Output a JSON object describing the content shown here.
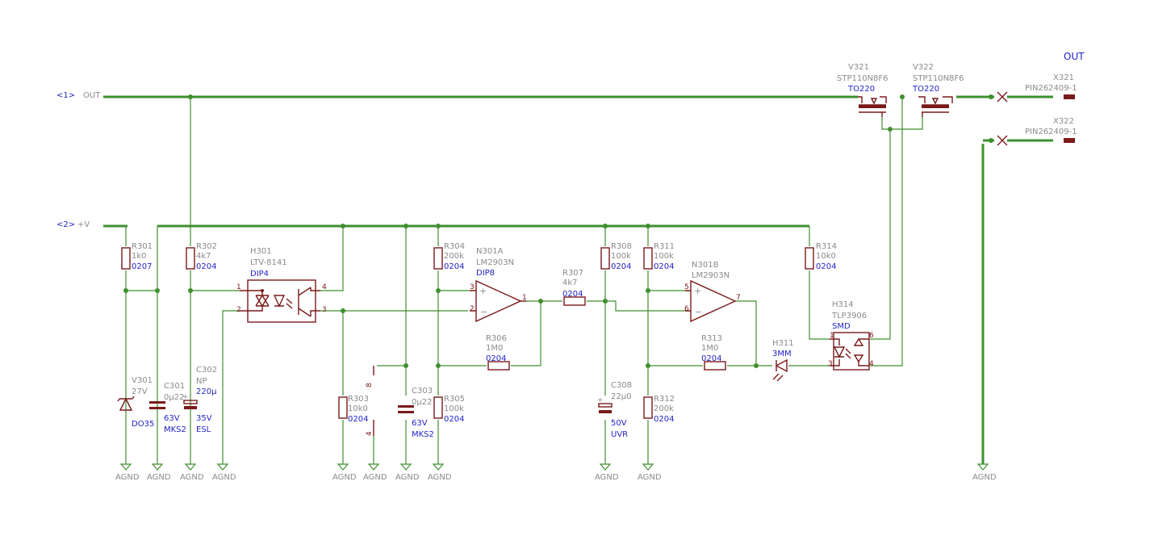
{
  "sheet": {
    "label": "OUT"
  },
  "nets": {
    "out_ref": "<1>",
    "out_name": "OUT",
    "vplus_ref": "<2>",
    "vplus_name": "+V"
  },
  "gnd_label": "AGND",
  "components": {
    "R301": {
      "name": "R301",
      "value": "1k0",
      "pkg": "0207"
    },
    "R302": {
      "name": "R302",
      "value": "4k7",
      "pkg": "0204"
    },
    "H301": {
      "name": "H301",
      "value": "LTV-8141",
      "pkg": "DIP4"
    },
    "V301": {
      "name": "V301",
      "value": "27V",
      "pkg": "DO35"
    },
    "C301": {
      "name": "C301",
      "value": "0µ22",
      "rating": "63V",
      "pkg": "MKS2"
    },
    "C302": {
      "name": "C302",
      "type": "NP",
      "value": "220µ",
      "rating": "35V",
      "pkg": "ESL"
    },
    "R303": {
      "name": "R303",
      "value": "10k0",
      "pkg": "0204"
    },
    "C303": {
      "name": "C303",
      "value": "0µ22",
      "rating": "63V",
      "pkg": "MKS2"
    },
    "R304": {
      "name": "R304",
      "value": "200k",
      "pkg": "0204"
    },
    "R305": {
      "name": "R305",
      "value": "100k",
      "pkg": "0204"
    },
    "N301A": {
      "name": "N301A",
      "value": "LM2903N",
      "pkg": "DIP8"
    },
    "N301B": {
      "name": "N301B",
      "value": "LM2903N"
    },
    "R306": {
      "name": "R306",
      "value": "1M0",
      "pkg": "0204"
    },
    "R307": {
      "name": "R307",
      "value": "4k7",
      "pkg": "0204"
    },
    "R308": {
      "name": "R308",
      "value": "100k",
      "pkg": "0204"
    },
    "C308": {
      "name": "C308",
      "value": "22µ0",
      "rating": "50V",
      "pkg": "UVR"
    },
    "R311": {
      "name": "R311",
      "value": "100k",
      "pkg": "0204"
    },
    "R312": {
      "name": "R312",
      "value": "200k",
      "pkg": "0204"
    },
    "R313": {
      "name": "R313",
      "value": "1M0",
      "pkg": "0204"
    },
    "H311": {
      "name": "H311",
      "pkg": "3MM"
    },
    "R314": {
      "name": "R314",
      "value": "10k0",
      "pkg": "0204"
    },
    "H314": {
      "name": "H314",
      "value": "TLP3906",
      "pkg": "SMD"
    },
    "V321": {
      "name": "V321",
      "value": "STP110N8F6",
      "pkg": "TO220"
    },
    "V322": {
      "name": "V322",
      "value": "STP110N8F6",
      "pkg": "TO220"
    },
    "X321": {
      "name": "X321",
      "value": "PIN262409-1"
    },
    "X322": {
      "name": "X322",
      "value": "PIN262409-1"
    }
  },
  "pins": {
    "h301_1": "1",
    "h301_2": "2",
    "h301_3": "3",
    "h301_4": "4",
    "na_3": "3",
    "na_2": "2",
    "na_1": "1",
    "nb_5": "5",
    "nb_6": "6",
    "nb_7": "7",
    "h314_1": "1",
    "h314_3": "3",
    "h314_4": "4",
    "h314_6": "6",
    "pwr_8": "8",
    "pwr_4": "4"
  }
}
